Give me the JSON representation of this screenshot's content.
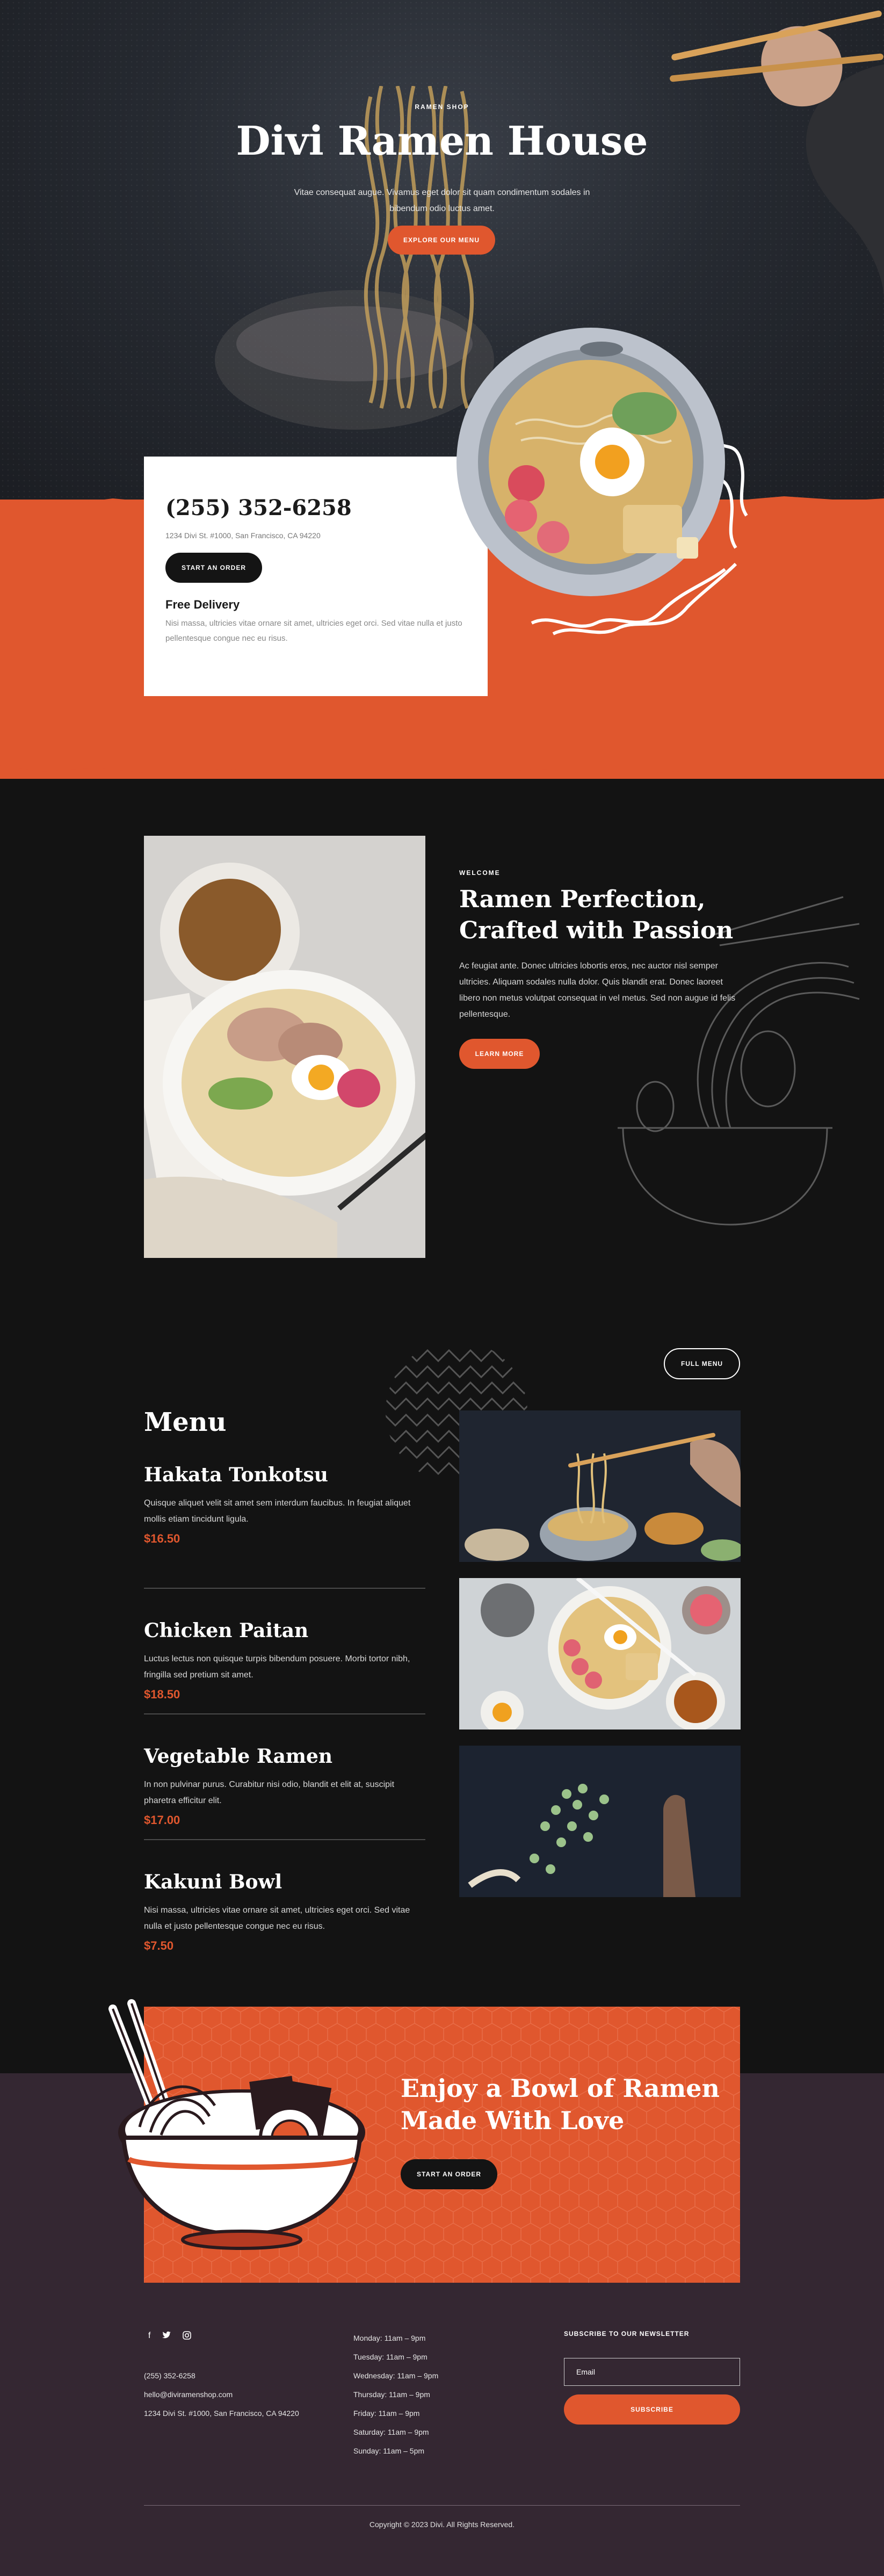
{
  "hero": {
    "eyebrow": "RAMEN SHOP",
    "title": "Divi Ramen House",
    "subtitle": "Vitae consequat augue. Vivamus eget dolor sit quam condimentum sodales in bibendum odio luctus amet.",
    "cta_label": "EXPLORE OUR MENU"
  },
  "contact_card": {
    "phone": "(255) 352-6258",
    "address": "1234 Divi St. #1000, San Francisco, CA 94220",
    "order_label": "START AN ORDER",
    "delivery_title": "Free Delivery",
    "delivery_text": "Nisi massa, ultricies vitae ornare sit amet, ultricies eget orci. Sed vitae nulla et justo pellentesque congue nec eu risus."
  },
  "welcome": {
    "eyebrow": "WELCOME",
    "title": "Ramen Perfection, Crafted with Passion",
    "text": "Ac feugiat ante. Donec ultricies lobortis eros, nec auctor nisl semper ultricies. Aliquam sodales nulla dolor. Quis blandit erat. Donec laoreet libero non metus volutpat consequat in vel metus. Sed non augue id felis pellentesque.",
    "cta_label": "LEARN MORE"
  },
  "menu": {
    "title": "Menu",
    "full_menu_label": "FULL MENU",
    "items": [
      {
        "name": "Hakata Tonkotsu",
        "description": "Quisque aliquet velit sit amet sem interdum faucibus. In feugiat aliquet mollis etiam tincidunt ligula.",
        "price": "$16.50"
      },
      {
        "name": "Chicken Paitan",
        "description": "Luctus lectus non quisque turpis bibendum posuere. Morbi tortor nibh, fringilla sed pretium sit amet.",
        "price": "$18.50"
      },
      {
        "name": "Vegetable Ramen",
        "description": "In non pulvinar purus. Curabitur nisi odio, blandit et elit at, suscipit pharetra efficitur elit.",
        "price": "$17.00"
      },
      {
        "name": "Kakuni Bowl",
        "description": "Nisi massa, ultricies vitae ornare sit amet, ultricies eget orci. Sed vitae nulla et justo pellentesque congue nec eu risus.",
        "price": "$7.50"
      }
    ]
  },
  "cta": {
    "title": "Enjoy a Bowl of Ramen Made With Love",
    "button_label": "START AN ORDER"
  },
  "footer": {
    "social": [
      "facebook-icon",
      "twitter-icon",
      "instagram-icon"
    ],
    "phone": "(255) 352-6258",
    "email": "hello@diviramenshop.com",
    "address": "1234 Divi St. #1000, San Francisco, CA 94220",
    "hours": [
      "Monday: 11am – 9pm",
      "Tuesday: 11am – 9pm",
      "Wednesday: 11am – 9pm",
      "Thursday: 11am – 9pm",
      "Friday: 11am – 9pm",
      "Saturday: 11am – 9pm",
      "Sunday: 11am – 5pm"
    ],
    "newsletter_title": "SUBSCRIBE TO OUR NEWSLETTER",
    "email_placeholder": "Email",
    "subscribe_label": "SUBSCRIBE",
    "copyright": "Copyright © 2023 Divi. All Rights Reserved."
  },
  "colors": {
    "accent": "#e0572e",
    "dark": "#131313",
    "footer_bg": "#342732"
  }
}
